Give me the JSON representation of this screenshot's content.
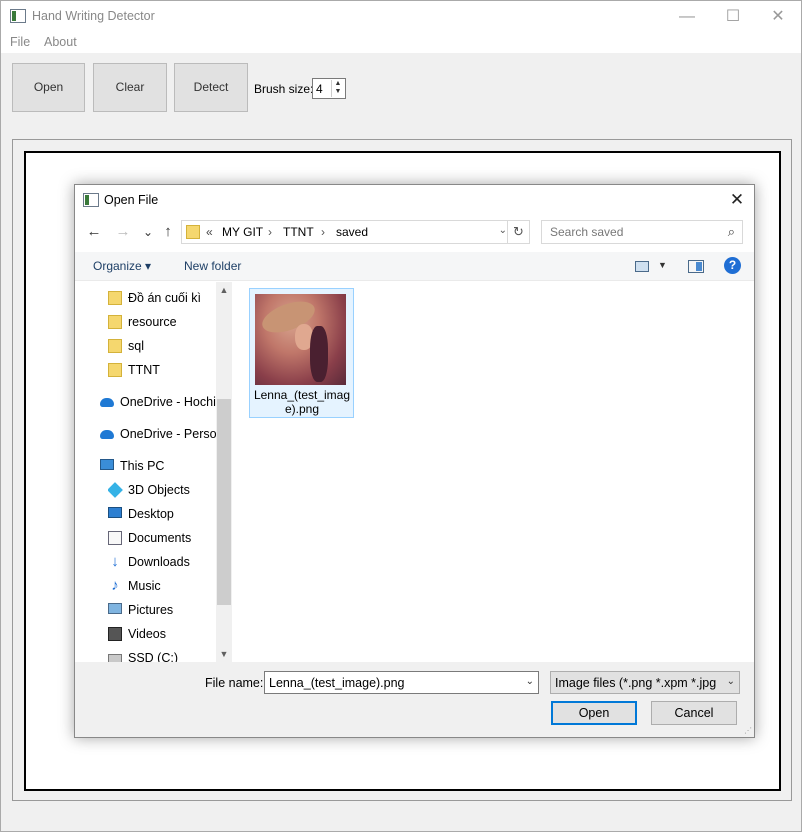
{
  "window": {
    "title": "Hand Writing Detector",
    "controls": {
      "minimize": "—",
      "maximize": "☐",
      "close": "✕"
    }
  },
  "menu": {
    "file": "File",
    "about": "About"
  },
  "toolbar": {
    "open": "Open",
    "clear": "Clear",
    "detect": "Detect",
    "brush_label": "Brush size:",
    "brush_value": "4"
  },
  "dialog": {
    "title": "Open File",
    "close": "✕",
    "nav": {
      "back": "←",
      "forward": "→",
      "recent": "⌄",
      "up": "↑"
    },
    "breadcrumb": {
      "overflow": "«",
      "parts": [
        "MY GIT",
        "TTNT",
        "saved"
      ],
      "sep": "›"
    },
    "search_placeholder": "Search saved",
    "commands": {
      "organize": "Organize ▾",
      "new_folder": "New folder",
      "help": "?"
    },
    "nav_items": [
      {
        "label": "Đồ án cuối kì",
        "icon": "folder-icon"
      },
      {
        "label": "resource",
        "icon": "folder-icon"
      },
      {
        "label": "sql",
        "icon": "folder-icon"
      },
      {
        "label": "TTNT",
        "icon": "folder-icon"
      },
      {
        "label": "OneDrive - Hochiminh City University of Education",
        "icon": "onedrive-icon"
      },
      {
        "label": "OneDrive - Personal",
        "icon": "onedrive-icon"
      },
      {
        "label": "This PC",
        "icon": "this-pc-icon"
      },
      {
        "label": "3D Objects",
        "icon": "3d-objects-icon"
      },
      {
        "label": "Desktop",
        "icon": "desktop-icon"
      },
      {
        "label": "Documents",
        "icon": "documents-icon"
      },
      {
        "label": "Downloads",
        "icon": "downloads-icon"
      },
      {
        "label": "Music",
        "icon": "music-icon"
      },
      {
        "label": "Pictures",
        "icon": "pictures-icon"
      },
      {
        "label": "Videos",
        "icon": "videos-icon"
      },
      {
        "label": "SSD (C:)",
        "icon": "ssd-drive-icon"
      }
    ],
    "files": [
      {
        "name": "Lenna_(test_image).png"
      }
    ],
    "file_name_label": "File name:",
    "file_name_value": "Lenna_(test_image).png",
    "filter_value": "Image files (*.png *.xpm *.jpg *",
    "open_button": "Open",
    "cancel_button": "Cancel"
  }
}
